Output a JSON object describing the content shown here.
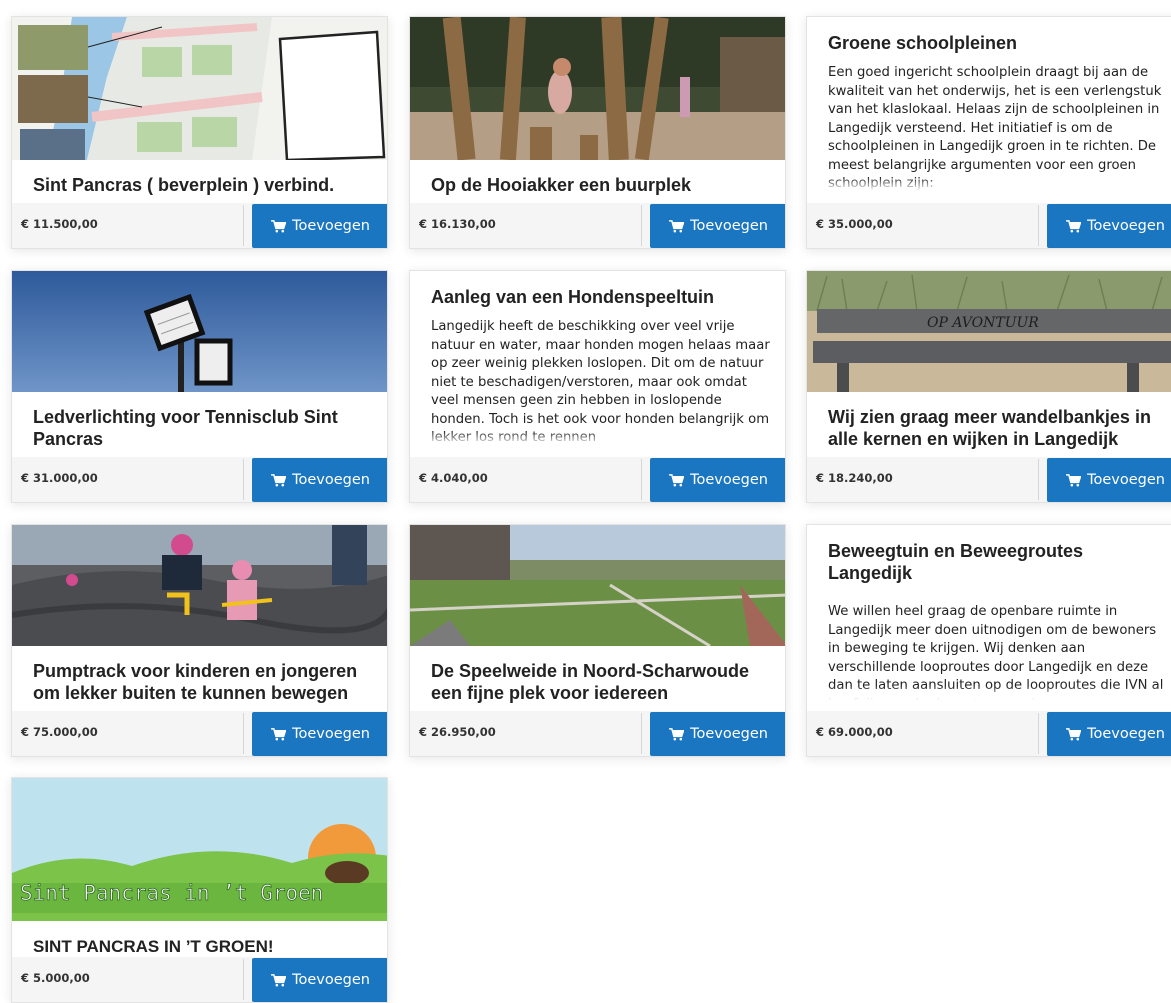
{
  "button_label": "Toevoegen",
  "projects": [
    {
      "title": "Sint Pancras ( beverplein ) verbind.",
      "price": "€ 11.500,00"
    },
    {
      "title": "Op de Hooiakker een buurplek",
      "price": "€ 16.130,00"
    },
    {
      "title": "Groene schoolpleinen",
      "description": "Een goed ingericht schoolplein draagt bij aan de kwaliteit van het onderwijs, het is een verlengstuk van het klaslokaal. Helaas zijn de schoolpleinen in Langedijk versteend.  Het initiatief is om de schoolpleinen in Langedijk groen in te richten. De meest belangrijke argumenten voor een groen schoolplein zijn:",
      "price": "€ 35.000,00"
    },
    {
      "title": "Ledverlichting voor Tennisclub Sint Pancras",
      "price": "€ 31.000,00"
    },
    {
      "title": "Aanleg van een Hondenspeeltuin",
      "description": "Langedijk heeft de beschikking over veel vrije natuur en water, maar honden mogen helaas maar op zeer weinig plekken loslopen. Dit om de natuur niet te beschadigen/verstoren, maar ook omdat veel mensen geen zin hebben in loslopende honden. Toch is het ook voor honden belangrijk om lekker los rond te rennen",
      "price": "€ 4.040,00"
    },
    {
      "title": "Wij zien graag meer wandelbankjes in alle kernen en wijken in Langedijk",
      "price": "€ 18.240,00",
      "bench_text": "OP AVONTUUR"
    },
    {
      "title": "Pumptrack voor kinderen en jongeren om lekker buiten te kunnen bewegen",
      "price": "€ 75.000,00"
    },
    {
      "title": "De Speelweide in Noord-Scharwoude een fijne plek voor iedereen",
      "price": "€ 26.950,00"
    },
    {
      "title": "Beweegtuin en Beweegroutes Langedijk",
      "description": "We willen heel graag de openbare ruimte in Langedijk meer doen uitnodigen om de bewoners in beweging te krijgen. Wij denken aan verschillende looproutes door Langedijk en deze dan te laten aansluiten op de looproutes die IVN al heeft liggen. In de routes van de",
      "price": "€ 69.000,00"
    },
    {
      "title": "SINT PANCRAS IN ’T GROEN!",
      "price": "€ 5.000,00",
      "banner_text": "Sint Pancras in ’t Groen"
    }
  ],
  "colors": {
    "button": "#1a76c1",
    "footer": "#f5f5f5",
    "title": "#222222"
  }
}
